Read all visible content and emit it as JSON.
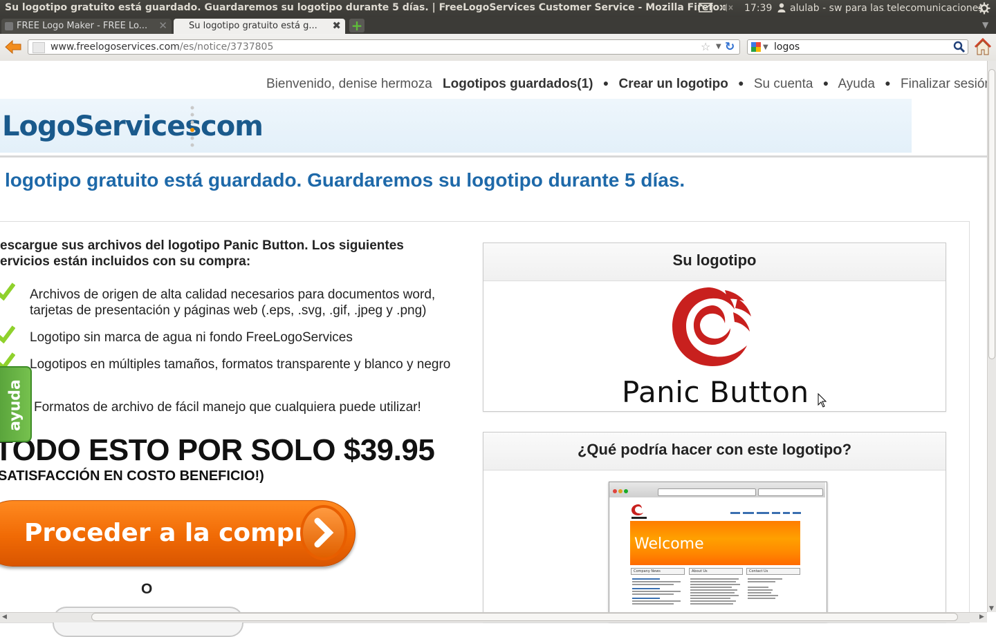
{
  "window": {
    "title": "Su logotipo gratuito está guardado. Guardaremos su logotipo durante 5 días. | FreeLogoServices Customer Service - Mozilla Firefox",
    "clock": "17:39",
    "user": "alulab - sw para las telecomunicaciones"
  },
  "tabs": [
    {
      "label": "FREE Logo Maker - FREE Lo...",
      "active": false
    },
    {
      "label": "Su logotipo gratuito está g...",
      "active": true
    }
  ],
  "toolbar": {
    "url_host": "www.freelogoservices.com",
    "url_path": "/es/notice/3737805",
    "search_value": "logos"
  },
  "usernav": {
    "welcome": "Bienvenido, denise hermoza",
    "saved": "Logotipos guardados(1)",
    "create": "Crear un logotipo",
    "account": "Su cuenta",
    "help": "Ayuda",
    "logout": "Finalizar sesión"
  },
  "header": {
    "logo_main": "LogoServices",
    "logo_tld": "com"
  },
  "headline": "logotipo gratuito está guardado. Guardaremos su logotipo durante 5 días.",
  "offer": {
    "intro": "escargue sus archivos del logotipo Panic Button. Los siguientes ervicios están incluidos con su compra:",
    "features": [
      "Archivos de origen de alta calidad necesarios para documentos word, tarjetas de presentación y páginas web (.eps, .svg, .gif, .jpeg y .png)",
      "Logotipo sin marca de agua ni fondo FreeLogoServices",
      "Logotipos en múltiples tamaños, formatos transparente y blanco y negro",
      "Formatos de archivo de fácil manejo que cualquiera puede utilizar!"
    ],
    "price_line": "TODO ESTO POR SOLO $39.95",
    "satisfaction": "SATISFACCIÓN EN COSTO BENEFICIO!)",
    "buy_button": "Proceder a la compra",
    "or_text": "O"
  },
  "ayuda_tab": "ayuda",
  "logo_box": {
    "title": "Su logotipo",
    "brand_name": "Panic Button"
  },
  "usage_box": {
    "title": "¿Qué podría hacer con este logotipo?",
    "mock_welcome": "Welcome",
    "mock_columns": [
      "Company News",
      "About Us",
      "Contact Us"
    ]
  },
  "colors": {
    "headline_blue": "#1e69a9",
    "buy_orange": "#f06a05",
    "logo_red": "#c8201e",
    "ayuda_green": "#6ab545"
  }
}
